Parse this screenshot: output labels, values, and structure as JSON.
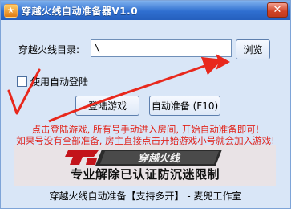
{
  "window": {
    "title": "穿越火线自动准备器V1.0",
    "close_glyph": "✕",
    "app_icon_glyph": "★"
  },
  "directory": {
    "label": "穿越火线目录:",
    "value": "\\",
    "browse_label": "浏览"
  },
  "auto_login": {
    "label": "使用自动登陆",
    "checked": false
  },
  "buttons": {
    "login_label": "登陆游戏",
    "auto_ready_label": "自动准备 (F10)"
  },
  "instructions": {
    "line1": "点击登陆游戏, 所有号手动进入房间, 开始自动准备即可!",
    "line2": "如果号没有全部准备, 房主直接点击开始游戏小号就会加入游戏!"
  },
  "banner": {
    "logo_text": "穿越火线",
    "main_text": "专业解除已认证防沉迷限制"
  },
  "footer": {
    "text": "穿越火线自动准备【支持多开】 - 麦兜工作室"
  },
  "colors": {
    "title_bar": "#2f6fd0",
    "window_bg": "#d9e6f7",
    "instruction_text": "#e2241b",
    "annotation_red": "#e8281c",
    "banner_bg": "#e9e3e6"
  }
}
